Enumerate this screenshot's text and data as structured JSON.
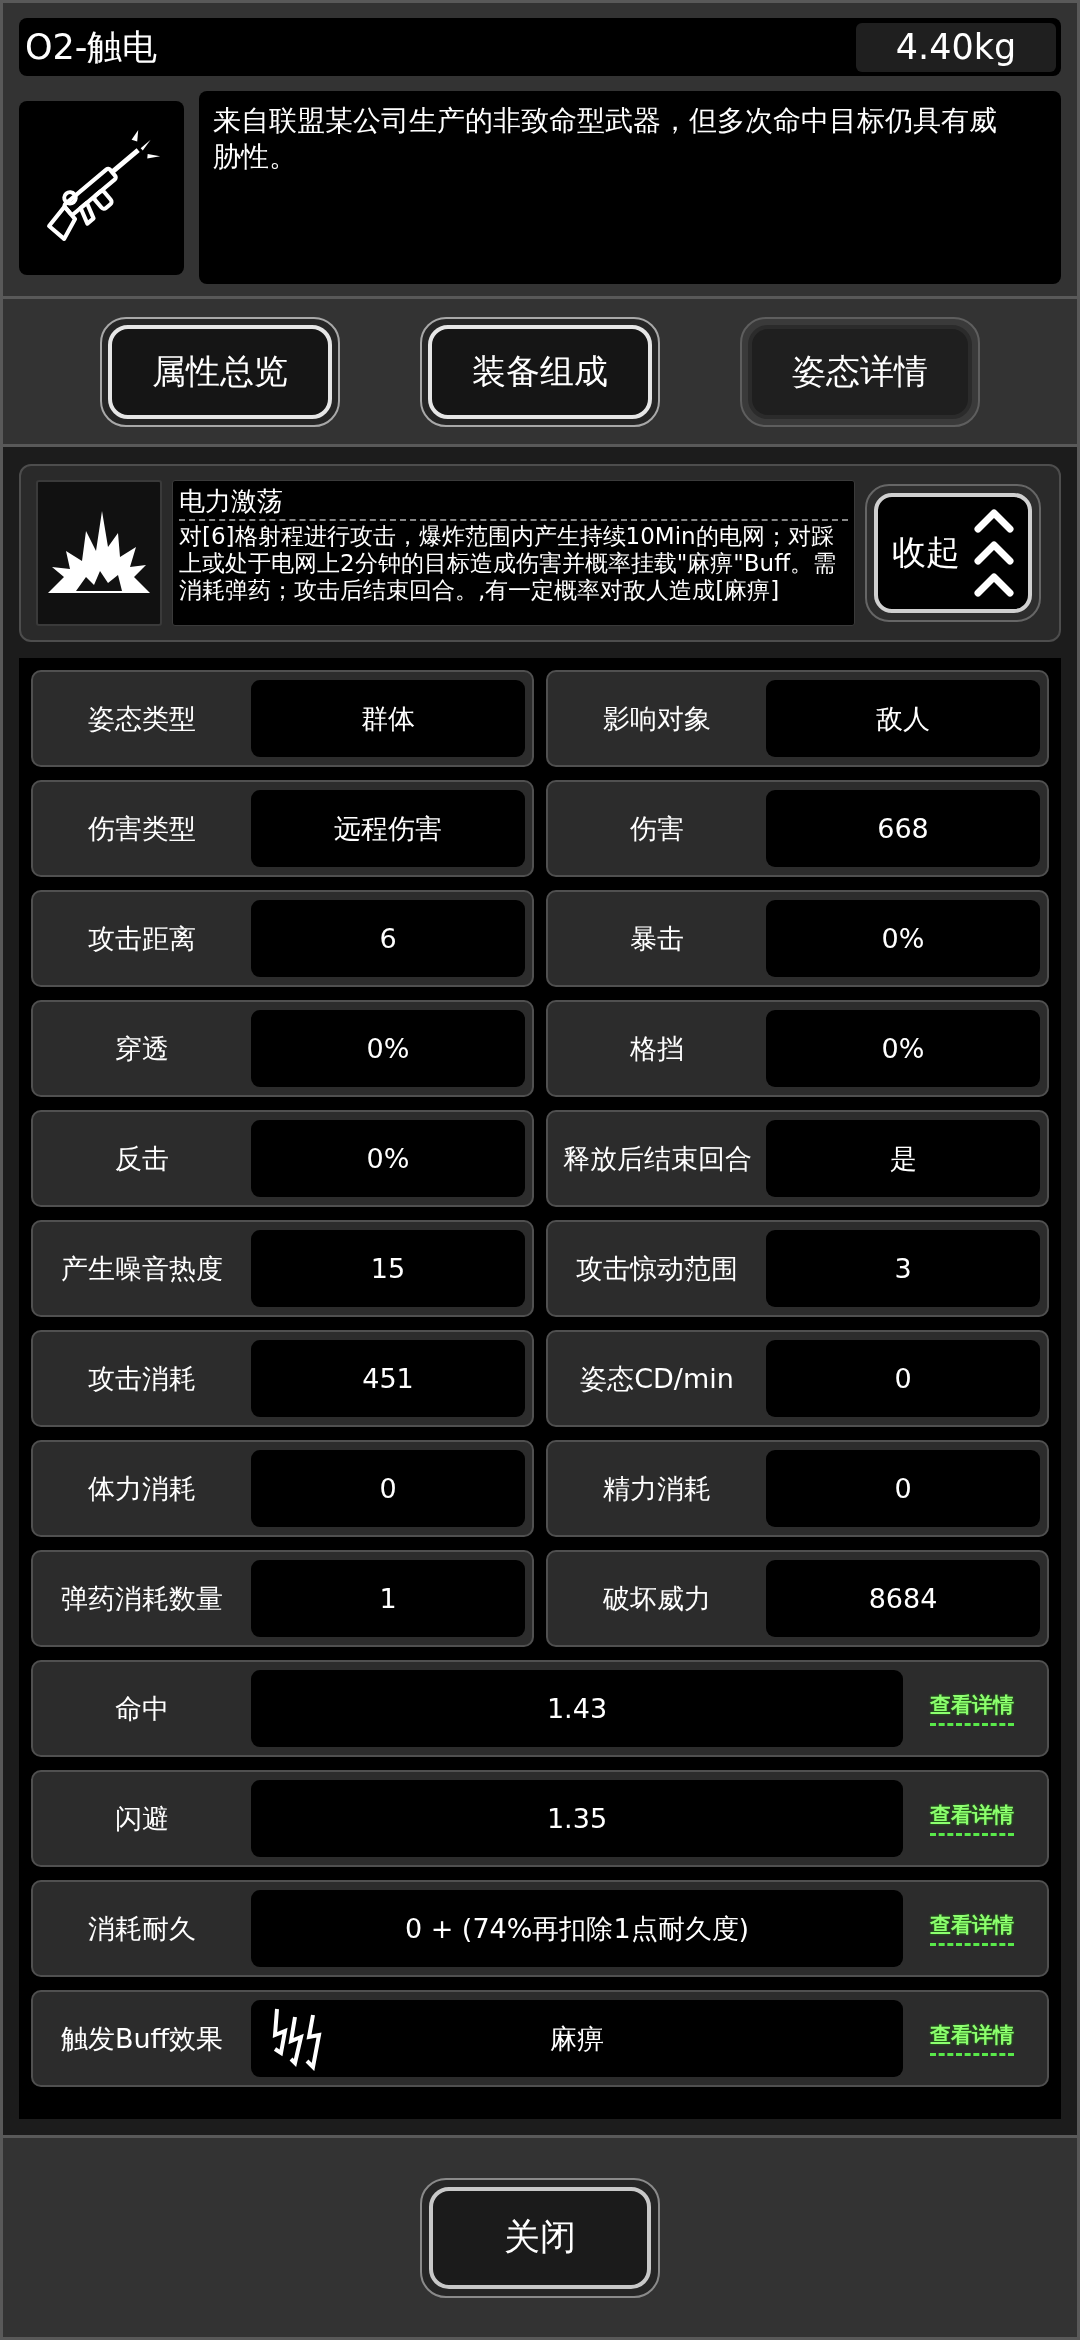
{
  "item": {
    "name": "O2-触电",
    "weight": "4.40kg",
    "description": "来自联盟某公司生产的非致命型武器，但多次命中目标仍具有威胁性。"
  },
  "tabs": [
    {
      "label": "属性总览",
      "selected": false
    },
    {
      "label": "装备组成",
      "selected": false
    },
    {
      "label": "姿态详情",
      "selected": true
    }
  ],
  "skill": {
    "name": "电力激荡",
    "description": "对[6]格射程进行攻击，爆炸范围内产生持续10Min的电网；对踩上或处于电网上2分钟的目标造成伤害并概率挂载\"麻痹\"Buff。需消耗弹药；攻击后结束回合。,有一定概率对敌人造成[麻痹]",
    "collapse_button": "收起"
  },
  "stats": [
    {
      "label": "姿态类型",
      "value": "群体"
    },
    {
      "label": "影响对象",
      "value": "敌人"
    },
    {
      "label": "伤害类型",
      "value": "远程伤害"
    },
    {
      "label": "伤害",
      "value": "668"
    },
    {
      "label": "攻击距离",
      "value": "6"
    },
    {
      "label": "暴击",
      "value": "0%"
    },
    {
      "label": "穿透",
      "value": "0%"
    },
    {
      "label": "格挡",
      "value": "0%"
    },
    {
      "label": "反击",
      "value": "0%"
    },
    {
      "label": "释放后结束回合",
      "value": "是"
    },
    {
      "label": "产生噪音热度",
      "value": "15"
    },
    {
      "label": "攻击惊动范围",
      "value": "3"
    },
    {
      "label": "攻击消耗",
      "value": "451"
    },
    {
      "label": "姿态CD/min",
      "value": "0"
    },
    {
      "label": "体力消耗",
      "value": "0"
    },
    {
      "label": "精力消耗",
      "value": "0"
    },
    {
      "label": "弹药消耗数量",
      "value": "1"
    },
    {
      "label": "破坏威力",
      "value": "8684"
    }
  ],
  "detail_rows": [
    {
      "kind": "value",
      "label": "命中",
      "value": "1.43",
      "link": "查看详情"
    },
    {
      "kind": "value",
      "label": "闪避",
      "value": "1.35",
      "link": "查看详情"
    },
    {
      "kind": "value",
      "label": "消耗耐久",
      "value": "0 + (74%再扣除1点耐久度)",
      "link": "查看详情"
    },
    {
      "kind": "buff",
      "label": "触发Buff效果",
      "value": "麻痹",
      "link": "查看详情"
    }
  ],
  "close_button": "关闭"
}
